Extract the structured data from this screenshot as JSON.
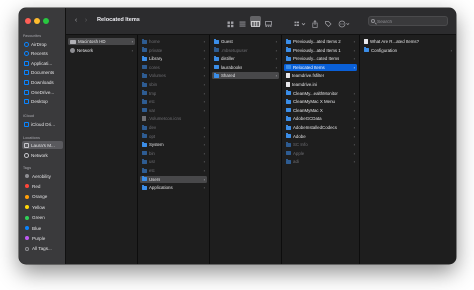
{
  "window": {
    "title": "Relocated Items",
    "traffic_lights": [
      "#ff5f57",
      "#febc2e",
      "#28c840"
    ]
  },
  "toolbar": {
    "back_icon": "chevron-left-icon",
    "forward_icon": "chevron-right-icon",
    "search_placeholder": "Search",
    "view_buttons": [
      "icon-view",
      "list-view",
      "column-view",
      "gallery-view"
    ],
    "selected_view": "column-view",
    "action_icons": [
      "group-icon",
      "share-icon",
      "tag-icon",
      "more-icon"
    ]
  },
  "sidebar": {
    "favourites_header": "Favourites",
    "favourites": [
      {
        "label": "AirDrop",
        "icon": "airdrop-icon"
      },
      {
        "label": "Recents",
        "icon": "clock-icon"
      },
      {
        "label": "Applicati...",
        "icon": "applications-icon"
      },
      {
        "label": "Documents",
        "icon": "document-icon"
      },
      {
        "label": "Downloads",
        "icon": "download-icon"
      },
      {
        "label": "OneDrive...",
        "icon": "cloud-icon"
      },
      {
        "label": "Desktop",
        "icon": "desktop-icon"
      }
    ],
    "icloud_header": "iCloud",
    "icloud": [
      {
        "label": "iCloud Dri...",
        "icon": "icloud-icon"
      }
    ],
    "locations_header": "Locations",
    "locations": [
      {
        "label": "Laura's M...",
        "icon": "laptop-icon",
        "selected": true
      },
      {
        "label": "Network",
        "icon": "globe-icon"
      }
    ],
    "tags_header": "Tags",
    "tags": [
      {
        "label": "Aerobility",
        "color": "#8e8e93"
      },
      {
        "label": "Red",
        "color": "#ff453a"
      },
      {
        "label": "Orange",
        "color": "#ff9f0a"
      },
      {
        "label": "Yellow",
        "color": "#ffd60a"
      },
      {
        "label": "Green",
        "color": "#30d158"
      },
      {
        "label": "Blue",
        "color": "#0a84ff"
      },
      {
        "label": "Purple",
        "color": "#bf5af2"
      },
      {
        "label": "All Tags...",
        "color": "none"
      }
    ]
  },
  "columns": [
    {
      "items": [
        {
          "label": "Macintosh HD",
          "type": "disk",
          "state": "hl",
          "chevron": true
        },
        {
          "label": "Network",
          "type": "globe",
          "state": "",
          "chevron": true
        }
      ]
    },
    {
      "items": [
        {
          "label": "home",
          "type": "folder",
          "state": "dim",
          "chevron": true
        },
        {
          "label": "private",
          "type": "folder",
          "state": "dim",
          "chevron": true
        },
        {
          "label": "Library",
          "type": "folder",
          "state": "",
          "chevron": true
        },
        {
          "label": "cores",
          "type": "folder",
          "state": "dim",
          "chevron": true
        },
        {
          "label": "Volumes",
          "type": "folder",
          "state": "dim",
          "chevron": true
        },
        {
          "label": "sbin",
          "type": "folder",
          "state": "dim",
          "chevron": true
        },
        {
          "label": "tmp",
          "type": "folder",
          "state": "dim",
          "chevron": true
        },
        {
          "label": "etc",
          "type": "folder",
          "state": "dim",
          "chevron": true
        },
        {
          "label": "var",
          "type": "folder",
          "state": "dim",
          "chevron": true
        },
        {
          "label": ".VolumeIcon.icns",
          "type": "doc",
          "state": "dim",
          "chevron": false
        },
        {
          "label": "dev",
          "type": "folder",
          "state": "dim",
          "chevron": true
        },
        {
          "label": "opt",
          "type": "folder",
          "state": "dim",
          "chevron": true
        },
        {
          "label": "System",
          "type": "folder",
          "state": "",
          "chevron": true
        },
        {
          "label": "bin",
          "type": "folder",
          "state": "dim",
          "chevron": true
        },
        {
          "label": "usr",
          "type": "folder",
          "state": "dim",
          "chevron": true
        },
        {
          "label": "etc",
          "type": "folder",
          "state": "dim",
          "chevron": true
        },
        {
          "label": "Users",
          "type": "folder",
          "state": "hl",
          "chevron": true
        },
        {
          "label": "Applications",
          "type": "folder",
          "state": "",
          "chevron": true
        }
      ]
    },
    {
      "items": [
        {
          "label": "Guest",
          "type": "folder",
          "state": "",
          "chevron": true
        },
        {
          "label": ".mbsetupuser",
          "type": "folder",
          "state": "dim",
          "chevron": true
        },
        {
          "label": "distiller",
          "type": "folder",
          "state": "",
          "chevron": true
        },
        {
          "label": "laurabooks",
          "type": "folder",
          "state": "",
          "chevron": true
        },
        {
          "label": "Shared",
          "type": "folder",
          "state": "hl",
          "chevron": true
        }
      ]
    },
    {
      "items": [
        {
          "label": "Previously...ated Items 2",
          "type": "folder",
          "state": "",
          "chevron": true
        },
        {
          "label": "Previously...ated Items 1",
          "type": "folder",
          "state": "",
          "chevron": true
        },
        {
          "label": "Previously...cated Items",
          "type": "folder",
          "state": "",
          "chevron": true
        },
        {
          "label": "Relocated Items",
          "type": "folder",
          "state": "sel",
          "chevron": true
        },
        {
          "label": "teamdrive.fsfilter",
          "type": "doc",
          "state": "",
          "chevron": false
        },
        {
          "label": "teamdrive.ini",
          "type": "doc",
          "state": "",
          "chevron": false
        },
        {
          "label": "CleanMy...ealthMonitor",
          "type": "folder",
          "state": "",
          "chevron": true
        },
        {
          "label": "CleanMyMac X Menu",
          "type": "folder",
          "state": "",
          "chevron": true
        },
        {
          "label": "CleanMyMac X",
          "type": "folder",
          "state": "",
          "chevron": true
        },
        {
          "label": "AdobeGCData",
          "type": "folder",
          "state": "",
          "chevron": true
        },
        {
          "label": "AdobeInstalledCodecs",
          "type": "folder",
          "state": "",
          "chevron": true
        },
        {
          "label": "Adobe",
          "type": "folder",
          "state": "",
          "chevron": true
        },
        {
          "label": "SC Info",
          "type": "folder",
          "state": "dim",
          "chevron": true
        },
        {
          "label": "Apple",
          "type": "folder",
          "state": "dim",
          "chevron": true
        },
        {
          "label": "adi",
          "type": "folder",
          "state": "dim",
          "chevron": true
        }
      ]
    },
    {
      "items": [
        {
          "label": "What Are R...ated Items?",
          "type": "doc",
          "state": "",
          "chevron": false
        },
        {
          "label": "Configuration",
          "type": "folder",
          "state": "",
          "chevron": true
        }
      ]
    }
  ]
}
